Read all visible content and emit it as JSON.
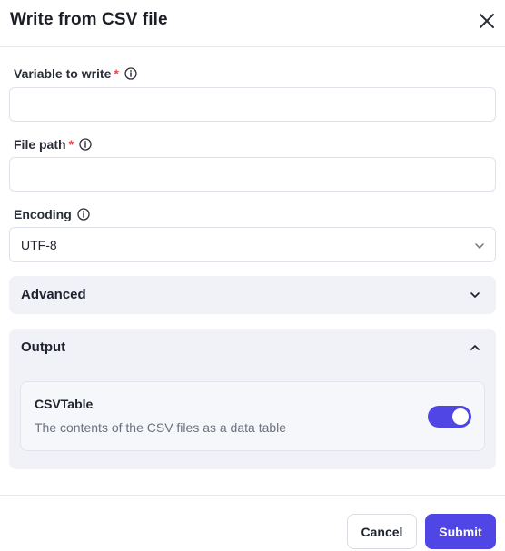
{
  "dialog": {
    "title": "Write from CSV file"
  },
  "fields": {
    "variable": {
      "label": "Variable to write",
      "required_mark": "*",
      "value": "",
      "placeholder": ""
    },
    "file_path": {
      "label": "File path",
      "required_mark": "*",
      "value": "",
      "placeholder": ""
    },
    "encoding": {
      "label": "Encoding",
      "selected": "UTF-8"
    }
  },
  "sections": {
    "advanced": {
      "title": "Advanced",
      "expanded": false
    },
    "output": {
      "title": "Output",
      "expanded": true,
      "items": [
        {
          "name": "CSVTable",
          "description": "The contents of the CSV files as a data table",
          "enabled": true
        }
      ]
    }
  },
  "footer": {
    "cancel_label": "Cancel",
    "submit_label": "Submit"
  },
  "colors": {
    "accent": "#4f46e5",
    "required": "#e5484d",
    "section_bg": "#f0f2f7"
  },
  "icons": {
    "close": "close-icon",
    "info": "info-icon",
    "chevron_down": "chevron-down-icon",
    "chevron_up": "chevron-up-icon"
  }
}
